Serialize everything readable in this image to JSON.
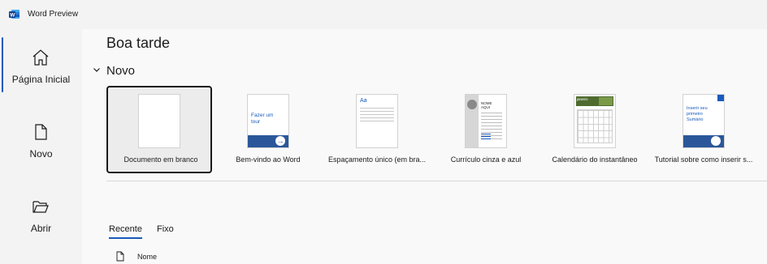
{
  "app": {
    "title": "Word Preview"
  },
  "colors": {
    "accent": "#185abd",
    "background": "#f3f3f3",
    "main_bg": "#f9f9f9"
  },
  "sidebar": {
    "items": [
      {
        "label": "Página Inicial",
        "icon": "home-icon",
        "active": true
      },
      {
        "label": "Novo",
        "icon": "new-document-icon",
        "active": false
      },
      {
        "label": "Abrir",
        "icon": "folder-open-icon",
        "active": false
      }
    ]
  },
  "main": {
    "greeting": "Boa tarde",
    "new_section": {
      "title": "Novo",
      "toggle_icon": "chevron-down-icon",
      "templates": [
        {
          "label": "Documento em branco",
          "selected": true
        },
        {
          "label": "Bem-vindo ao Word",
          "thumb_text": "Fazer um tour"
        },
        {
          "label": "Espaçamento único (em bra...",
          "thumb_text": "Aa"
        },
        {
          "label": "Currículo cinza e azul",
          "thumb_text": "NOME AQUI"
        },
        {
          "label": "Calendário do instantâneo",
          "thumb_text": "janeiro"
        },
        {
          "label": "Tutorial sobre como inserir s...",
          "thumb_text": "Inserir seu primeiro Sumário"
        }
      ]
    },
    "tabs": [
      {
        "label": "Recente",
        "active": true
      },
      {
        "label": "Fixo",
        "active": false
      }
    ],
    "file_list": {
      "columns": [
        "Nome"
      ],
      "icon": "file-icon"
    }
  }
}
